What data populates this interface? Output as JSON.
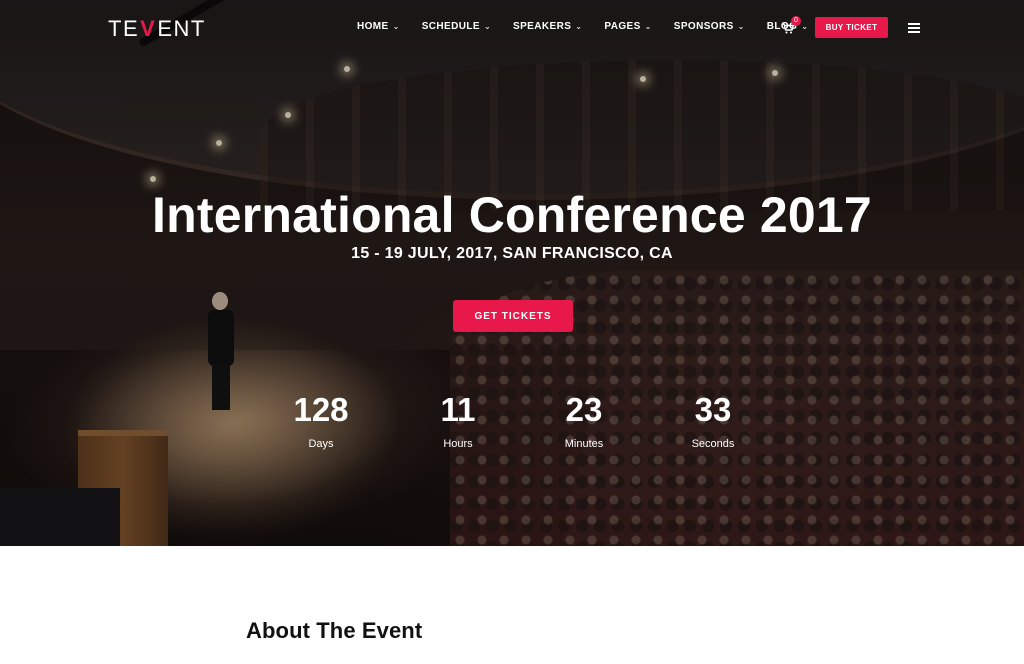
{
  "brand": {
    "logo_prefix": "TE",
    "logo_mark": "V",
    "logo_suffix": "ENT",
    "accent_color": "#e8194a"
  },
  "nav": {
    "items": [
      {
        "label": "HOME",
        "icon": "chevron-down-icon"
      },
      {
        "label": "SCHEDULE",
        "icon": "chevron-down-icon"
      },
      {
        "label": "SPEAKERS",
        "icon": "chevron-down-icon"
      },
      {
        "label": "PAGES",
        "icon": "chevron-down-icon"
      },
      {
        "label": "SPONSORS",
        "icon": "chevron-down-icon"
      },
      {
        "label": "BLOG",
        "icon": "chevron-down-icon"
      }
    ],
    "cart_icon": "cart-icon",
    "cart_count": "0",
    "buy_label": "BUY TICKET",
    "menu_icon": "hamburger-icon"
  },
  "hero": {
    "title": "International Conference 2017",
    "subtitle": "15 - 19 JULY, 2017, SAN FRANCISCO, CA",
    "cta_label": "GET TICKETS",
    "countdown": [
      {
        "value": "128",
        "label": "Days"
      },
      {
        "value": "11",
        "label": "Hours"
      },
      {
        "value": "23",
        "label": "Minutes"
      },
      {
        "value": "33",
        "label": "Seconds"
      }
    ]
  },
  "about": {
    "title": "About The Event"
  }
}
